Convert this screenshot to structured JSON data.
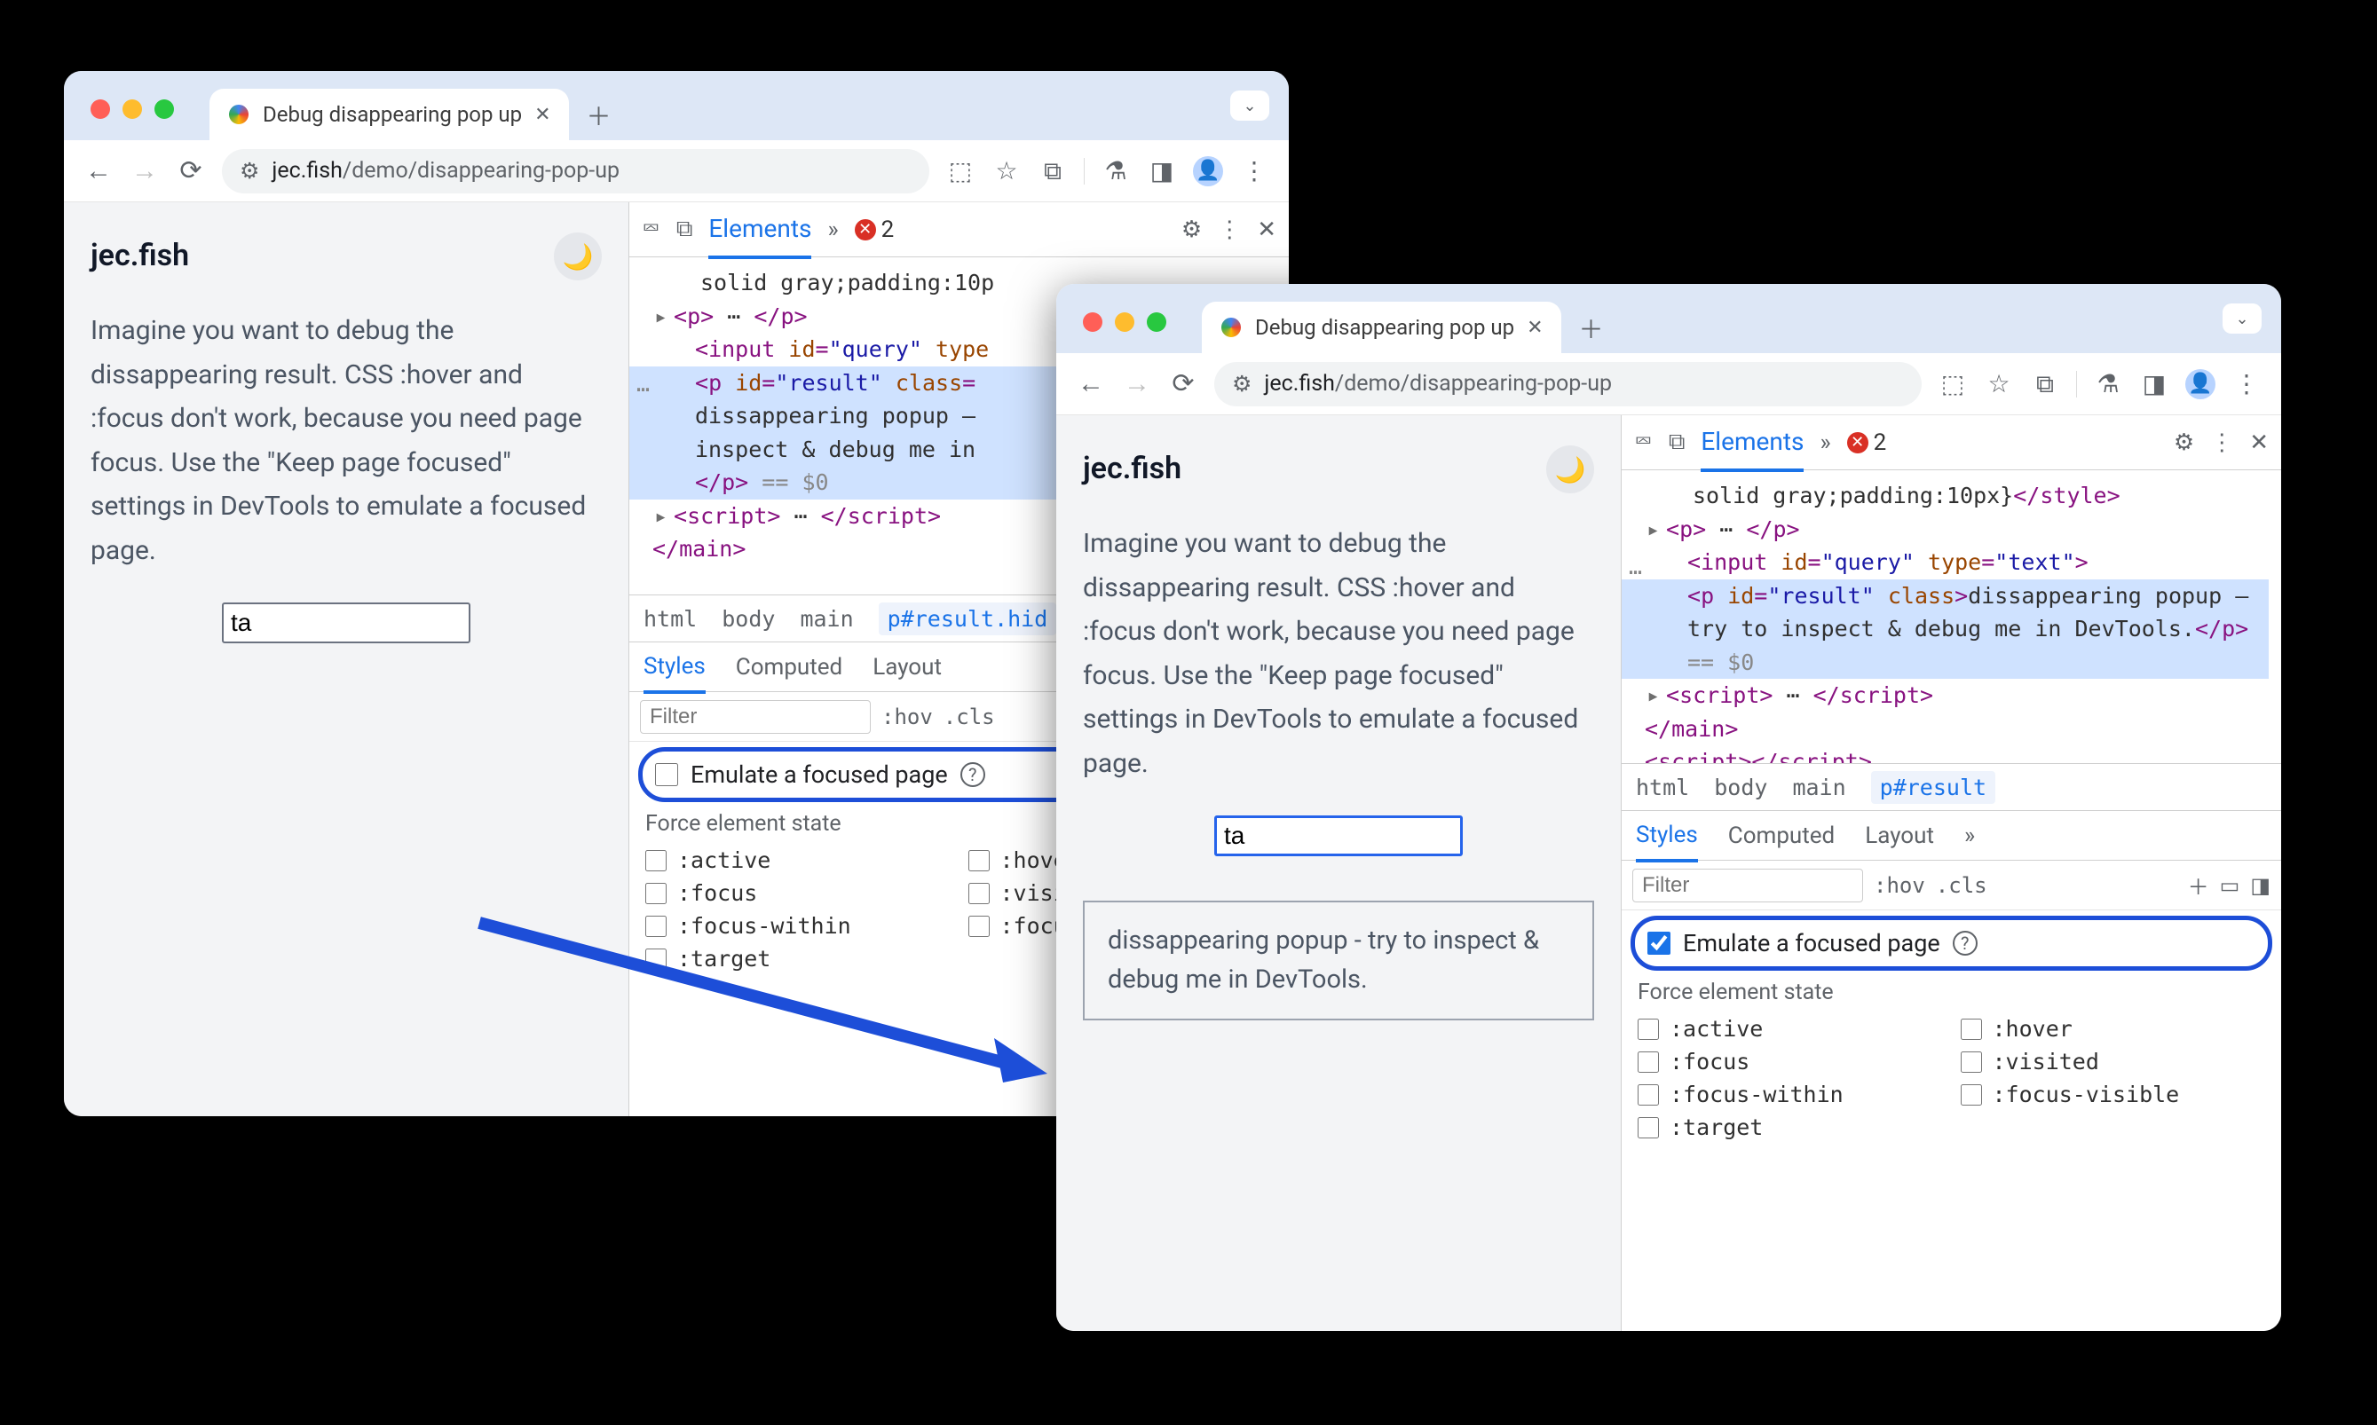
{
  "tab_title": "Debug disappearing pop up",
  "url_domain": "jec.fish",
  "url_path": "/demo/disappearing-pop-up",
  "page": {
    "site_name": "jec.fish",
    "instructions": "Imagine you want to debug the dissappearing result. CSS :hover and :focus don't work, because you need page focus. Use the \"Keep page focused\" settings in DevTools to emulate a focused page.",
    "input_value": "ta",
    "popup_text": "dissappearing popup - try to inspect & debug me in DevTools."
  },
  "devtools": {
    "panel": "Elements",
    "error_count": "2",
    "dom_style_text": "solid gray;padding:10p",
    "dom_style_text_full": "solid gray;padding:10px}",
    "dom_input_id": "query",
    "dom_input_type": "text",
    "dom_p_id": "result",
    "dom_p_class_left": "hid",
    "dom_p_text_left_l1": "dissappearing popup –",
    "dom_p_text_left_l2": "inspect & debug me in",
    "dom_p_text_right": "dissappearing popup – try to inspect & debug me in DevTools.",
    "dom_eq": "== $0",
    "crumbs": {
      "html": "html",
      "body": "body",
      "main": "main",
      "left_active": "p#result.hid",
      "right_active": "p#result"
    },
    "style_tabs": {
      "styles": "Styles",
      "computed": "Computed",
      "layout": "Layout"
    },
    "filter_placeholder": "Filter",
    "hov": ":hov",
    "cls": ".cls",
    "emulate_label": "Emulate a focused page",
    "force_label": "Force element state",
    "states": {
      "active": ":active",
      "hover": ":hover",
      "focus": ":focus",
      "visited": ":visited",
      "focus_within": ":focus-within",
      "focus_visible": ":focus-visible",
      "target": ":target",
      "hove": ":hove",
      "visi": ":visi",
      "focu": ":focu"
    },
    "dom_labels": {
      "p": "p",
      "input": "input",
      "style": "style",
      "script": "script",
      "main": "main",
      "id": "id",
      "class": "class",
      "type": "type"
    }
  }
}
